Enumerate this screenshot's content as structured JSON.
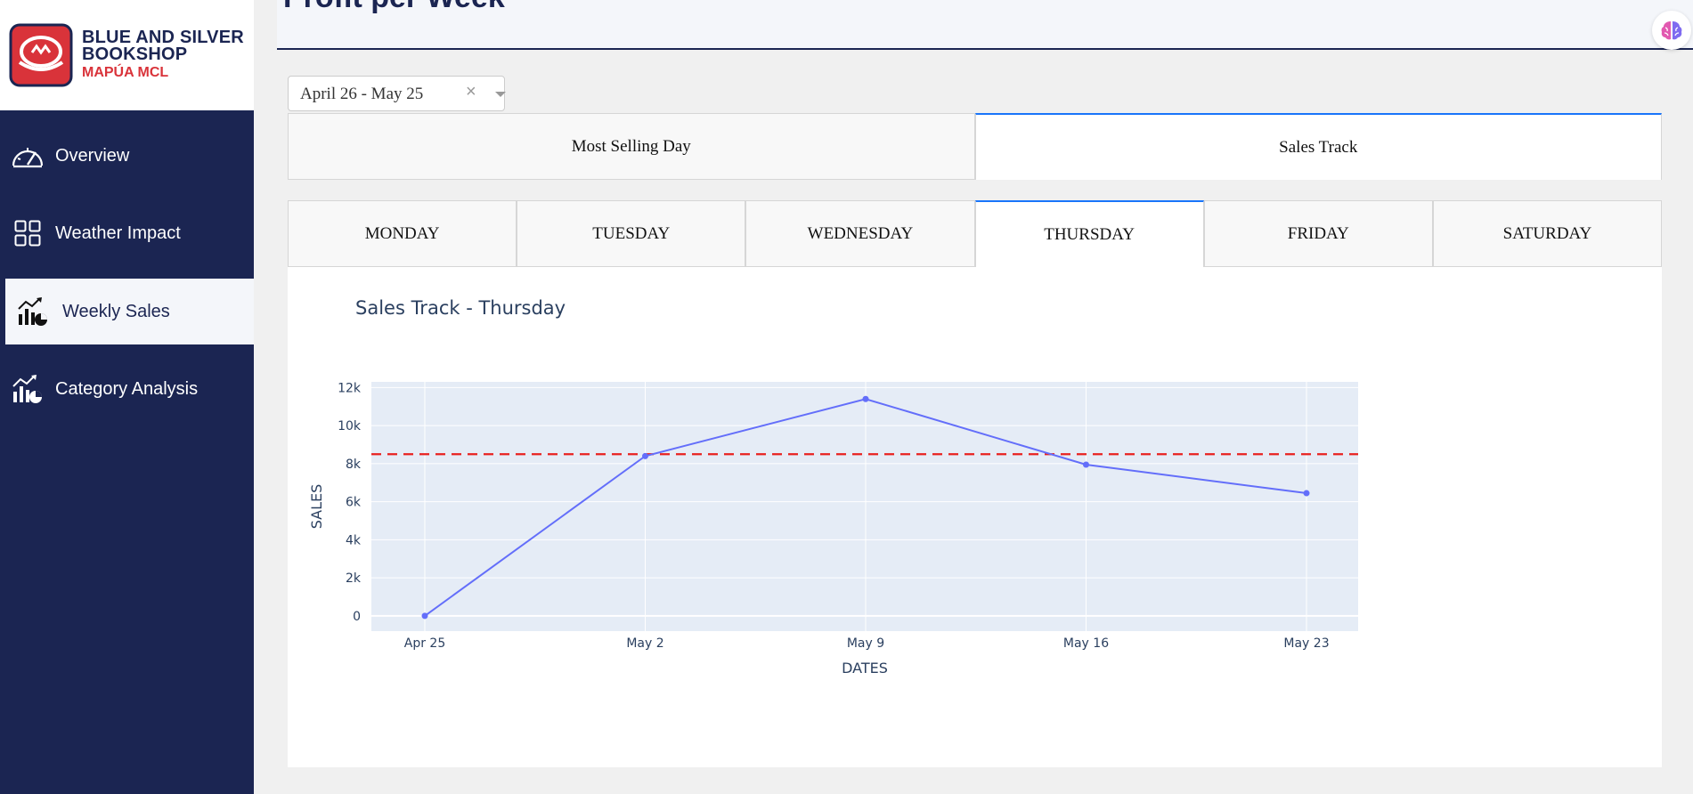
{
  "brand": {
    "line1": "BLUE AND SILVER",
    "line2": "BOOKSHOP",
    "sub": "MAPÚA MCL",
    "colors": {
      "primary": "#1b2552",
      "accent": "#d9333a"
    }
  },
  "sidebar": {
    "items": [
      {
        "label": "Overview",
        "icon": "gauge-icon",
        "active": false
      },
      {
        "label": "Weather Impact",
        "icon": "grid-icon",
        "active": false
      },
      {
        "label": "Weekly Sales",
        "icon": "chart-pie-icon",
        "active": true
      },
      {
        "label": "Category Analysis",
        "icon": "chart-pie-icon",
        "active": false
      }
    ]
  },
  "header": {
    "title": "Profit per Week",
    "assistant_icon": "brain-icon"
  },
  "date_filter": {
    "value": "April 26 - May 25",
    "clear_glyph": "×"
  },
  "tabs": {
    "top": [
      {
        "label": "Most Selling Day",
        "selected": false
      },
      {
        "label": "Sales Track",
        "selected": true
      }
    ],
    "days": [
      {
        "label": "MONDAY",
        "selected": false
      },
      {
        "label": "TUESDAY",
        "selected": false
      },
      {
        "label": "WEDNESDAY",
        "selected": false
      },
      {
        "label": "THURSDAY",
        "selected": true
      },
      {
        "label": "FRIDAY",
        "selected": false
      },
      {
        "label": "SATURDAY",
        "selected": false
      }
    ],
    "accent": "#1975fa"
  },
  "chart_data": {
    "type": "line",
    "title": "Sales Track - Thursday",
    "xlabel": "DATES",
    "ylabel": "SALES",
    "x": [
      "Apr 25",
      "May 2",
      "May 9",
      "May 16",
      "May 23"
    ],
    "values": [
      0,
      8400,
      11400,
      7950,
      6450
    ],
    "ylim": [
      -800,
      12300
    ],
    "y_ticks": [
      0,
      2000,
      4000,
      6000,
      8000,
      10000,
      12000
    ],
    "y_tick_labels": [
      "0",
      "2k",
      "4k",
      "6k",
      "8k",
      "10k",
      "12k"
    ],
    "reference_line": 8500,
    "grid": true,
    "colors": {
      "line": "#636efa",
      "reference": "#e8211f",
      "plot_bg": "#e5ecf6"
    }
  }
}
